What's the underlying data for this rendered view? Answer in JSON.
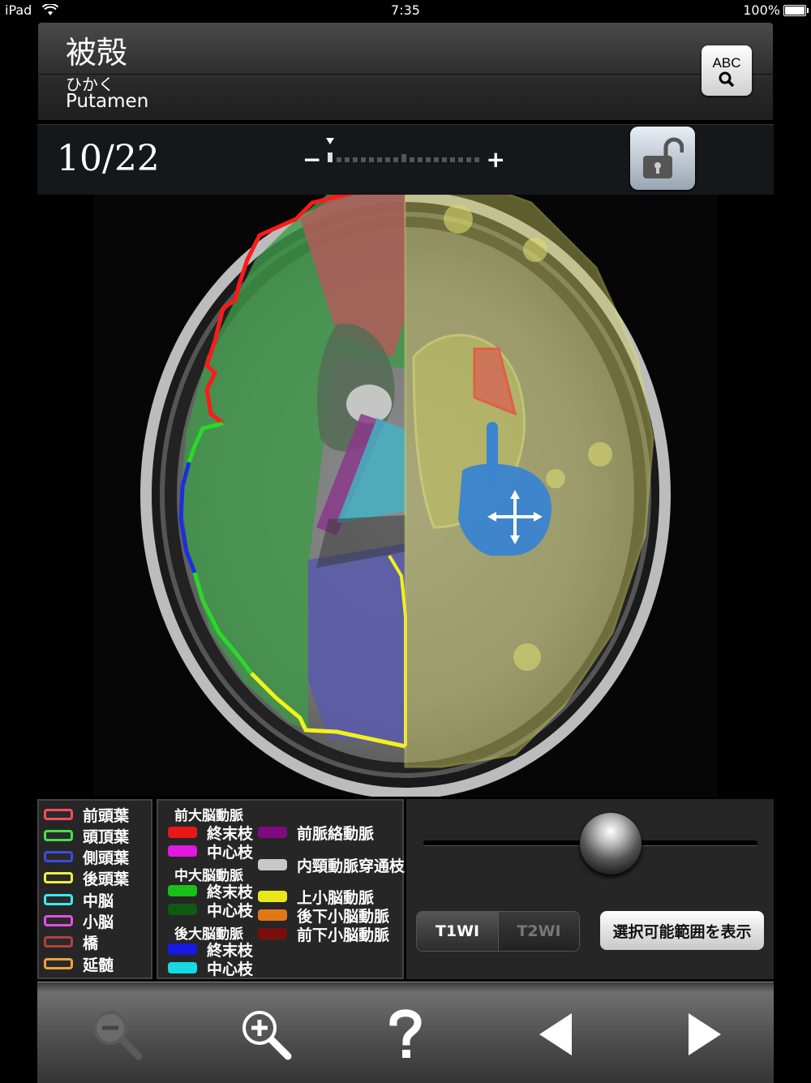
{
  "status": {
    "device": "iPad",
    "time": "7:35",
    "battery": "100%"
  },
  "header": {
    "title": "被殻",
    "reading": "ひかく",
    "english": "Putamen",
    "search_icon": "abc-search-icon",
    "search_label": "ABC"
  },
  "slice": {
    "current": "10/22",
    "minus": "−",
    "plus": "+",
    "lock_icon": "unlock-icon"
  },
  "legend_lobes": [
    {
      "label": "前頭葉",
      "color": "#ff4d5a"
    },
    {
      "label": "頭頂葉",
      "color": "#45e04a"
    },
    {
      "label": "側頭葉",
      "color": "#3b4ce0"
    },
    {
      "label": "後頭葉",
      "color": "#f0f03a"
    },
    {
      "label": "中脳",
      "color": "#3ee8f0"
    },
    {
      "label": "小脳",
      "color": "#e24ee6"
    },
    {
      "label": "橋",
      "color": "#b34040"
    },
    {
      "label": "延髄",
      "color": "#f0a040"
    }
  ],
  "legend_arteries": {
    "aca": {
      "header": "前大脳動脈",
      "items": [
        {
          "label": "終末枝",
          "color": "#e81818"
        },
        {
          "label": "中心枝",
          "color": "#e018e0"
        }
      ]
    },
    "mca": {
      "header": "中大脳動脈",
      "items": [
        {
          "label": "終末枝",
          "color": "#18c018"
        },
        {
          "label": "中心枝",
          "color": "#0e5a10"
        }
      ]
    },
    "pca": {
      "header": "後大脳動脈",
      "items": [
        {
          "label": "終末枝",
          "color": "#1818e0"
        },
        {
          "label": "中心枝",
          "color": "#18d8e0"
        }
      ]
    },
    "other": [
      {
        "label": "前脈絡動脈",
        "color": "#800a80"
      },
      {
        "label": "内頸動脈穿通枝",
        "color": "#c8c8c8"
      },
      {
        "label": "上小脳動脈",
        "color": "#e8e818"
      },
      {
        "label": "後下小脳動脈",
        "color": "#e07818"
      },
      {
        "label": "前下小脳動脈",
        "color": "#7a0e0e"
      }
    ]
  },
  "controls": {
    "opacity_slider": 0.5,
    "seg_t1": "T1WI",
    "seg_t2": "T2WI",
    "selected_sequence": "T1WI",
    "show_range": "選択可能範囲を表示"
  },
  "toolbar": {
    "zoom_out_icon": "zoom-out-icon",
    "zoom_in_icon": "zoom-in-icon",
    "help_icon": "help-icon",
    "prev_icon": "prev-arrow-icon",
    "next_icon": "next-arrow-icon"
  }
}
